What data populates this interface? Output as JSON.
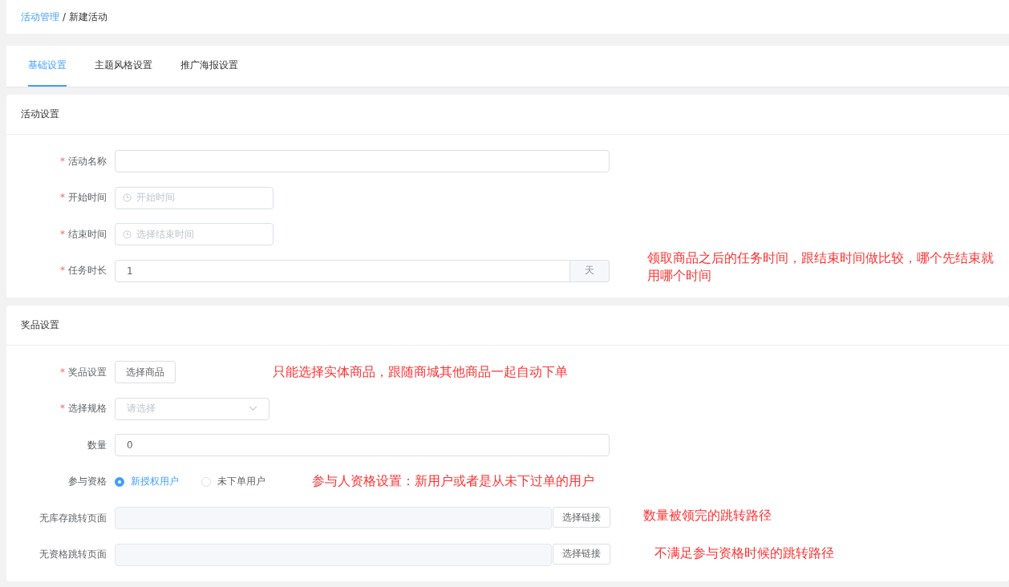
{
  "breadcrumb": [
    {
      "label": "活动管理",
      "link": true
    },
    {
      "label": "新建活动",
      "link": false
    }
  ],
  "breadcrumb_separator": "/",
  "required_mark": "*",
  "tabs": [
    {
      "label": "基础设置",
      "selected": true
    },
    {
      "label": "主题风格设置",
      "selected": false
    },
    {
      "label": "推广海报设置",
      "selected": false
    }
  ],
  "sections": [
    {
      "title": "活动设置",
      "fields": [
        {
          "kind": "text",
          "label": "活动名称",
          "required": true
        },
        {
          "kind": "date",
          "label": "开始时间",
          "required": true,
          "placeholder": "开始时间"
        },
        {
          "kind": "date",
          "label": "结束时间",
          "required": true,
          "placeholder": "选择结束时间"
        },
        {
          "kind": "duration",
          "label": "任务时长",
          "required": true,
          "value": "1",
          "unit": "天",
          "note": "领取商品之后的任务时间，跟结束时间做比较，哪个先结束就用哪个时间"
        }
      ]
    },
    {
      "title": "奖品设置",
      "fields": [
        {
          "kind": "button",
          "label": "奖品设置",
          "required": true,
          "button": "选择商品",
          "note": "只能选择实体商品，跟随商城其他商品一起自动下单"
        },
        {
          "kind": "select",
          "label": "选择规格",
          "required": true,
          "placeholder": "请选择"
        },
        {
          "kind": "text",
          "label": "数量",
          "required": false,
          "value": "0"
        },
        {
          "kind": "radio",
          "label": "参与资格",
          "required": false,
          "options": [
            {
              "label": "新授权用户",
              "selected": true
            },
            {
              "label": "未下单用户",
              "selected": false
            }
          ],
          "note": "参与人资格设置：新用户或者是从未下过单的用户"
        },
        {
          "kind": "link",
          "label": "无库存跳转页面",
          "required": false,
          "button": "选择链接",
          "note": "数量被领完的跳转路径"
        },
        {
          "kind": "link",
          "label": "无资格跳转页面",
          "required": false,
          "button": "选择链接",
          "note": "不满足参与资格时候的跳转路径"
        }
      ]
    }
  ]
}
